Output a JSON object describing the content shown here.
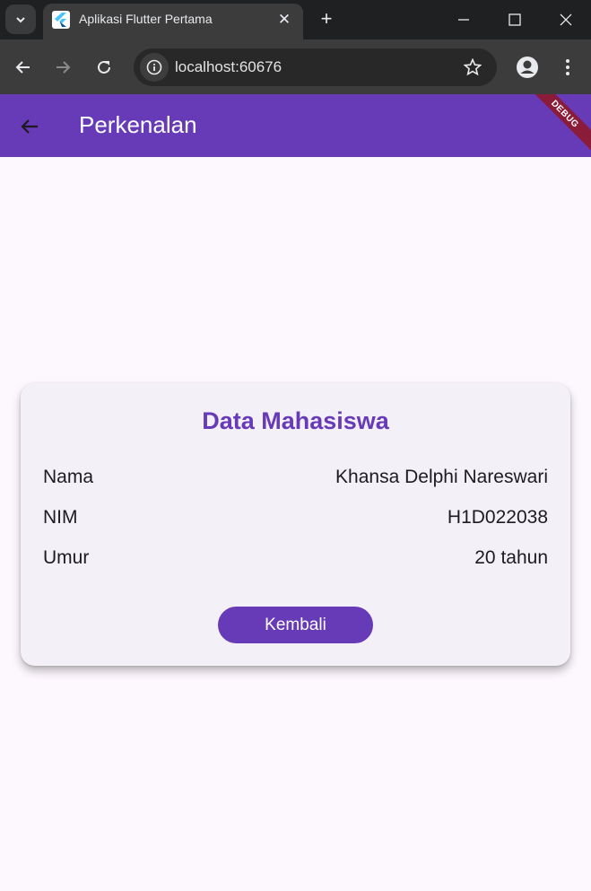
{
  "browser": {
    "tab_title": "Aplikasi Flutter Pertama",
    "url": "localhost:60676"
  },
  "appbar": {
    "title": "Perkenalan",
    "debug_label": "DEBUG",
    "color": "#673ab7"
  },
  "card": {
    "title": "Data Mahasiswa",
    "rows": [
      {
        "label": "Nama",
        "value": "Khansa Delphi Nareswari"
      },
      {
        "label": "NIM",
        "value": "H1D022038"
      },
      {
        "label": "Umur",
        "value": "20 tahun"
      }
    ],
    "button_label": "Kembali"
  },
  "icons": [
    "tab-search-icon",
    "flutter-favicon-icon",
    "close-tab-icon",
    "new-tab-icon",
    "minimize-icon",
    "maximize-icon",
    "close-window-icon",
    "back-icon",
    "forward-icon",
    "reload-icon",
    "site-info-icon",
    "bookmark-star-icon",
    "profile-icon",
    "menu-icon",
    "back-arrow-icon"
  ]
}
